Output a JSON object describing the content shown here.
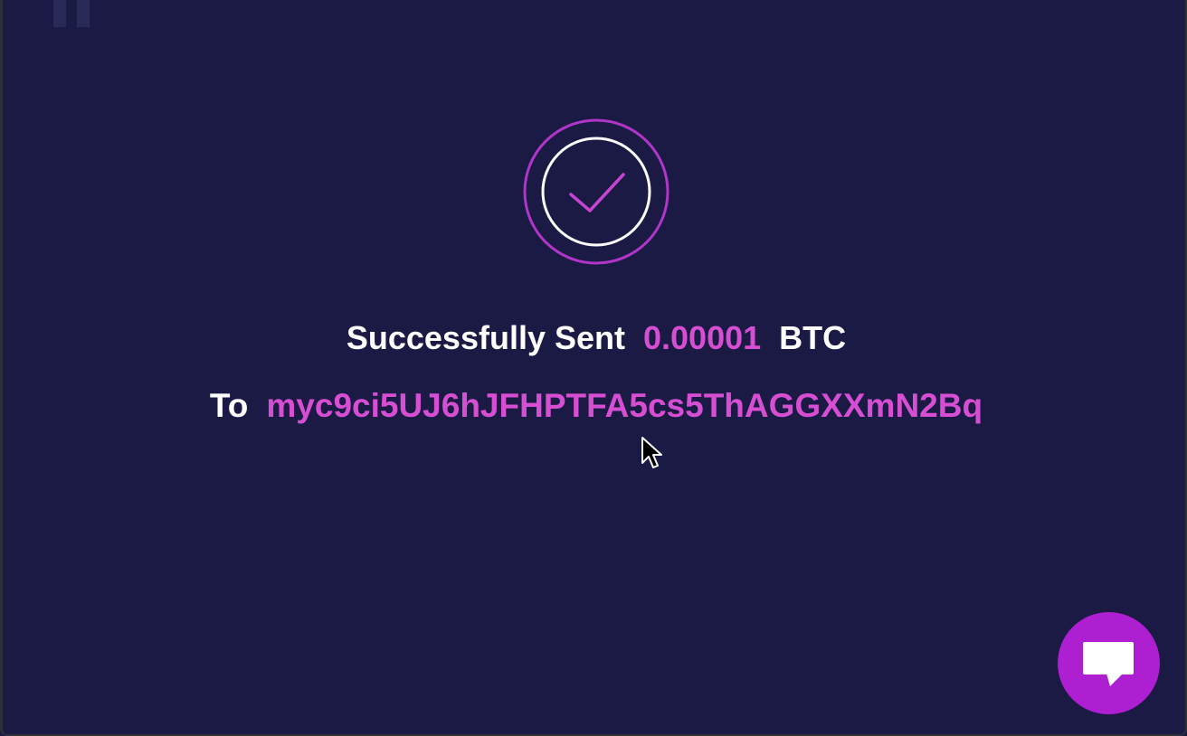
{
  "colors": {
    "background": "#1a1a44",
    "accent": "#d64ed2",
    "ring_outer": "#b035c8",
    "text": "#ffffff",
    "chat_button": "#ad1fd0"
  },
  "success": {
    "icon": "check-circle-icon",
    "label_sent": "Successfully Sent",
    "amount": "0.00001",
    "currency": "BTC",
    "label_to": "To",
    "address": "myc9ci5UJ6hJFHPTFA5cs5ThAGGXXmN2Bq"
  },
  "chat": {
    "icon": "chat-bubble-icon"
  }
}
